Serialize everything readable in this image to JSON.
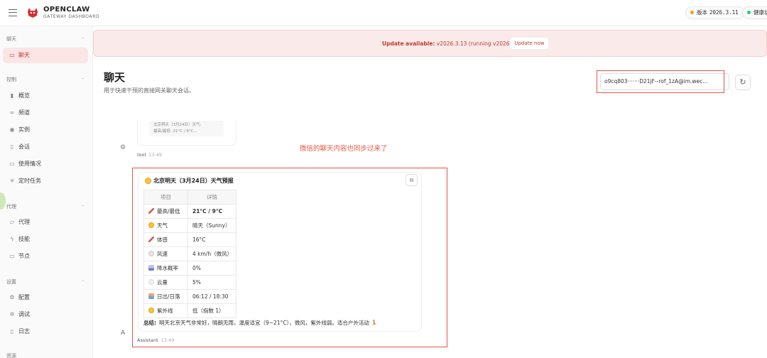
{
  "topbar": {
    "brand_name": "OPENCLAW",
    "brand_subtitle": "GATEWAY DASHBOARD",
    "version_label": "版本",
    "version_value": "2026.3.11",
    "health_label": "健康状"
  },
  "sidebar": {
    "sections": [
      {
        "title": "聊天",
        "chevron": "–"
      },
      {
        "title": "控制",
        "chevron": "–"
      },
      {
        "title": "代理",
        "chevron": "–"
      },
      {
        "title": "设置",
        "chevron": "–"
      },
      {
        "title": "资源",
        "chevron": ""
      }
    ],
    "items": [
      {
        "label": "聊天",
        "icon": "chat-icon",
        "active": true
      },
      {
        "label": "概览",
        "icon": "bar-chart-icon"
      },
      {
        "label": "频道",
        "icon": "link-icon"
      },
      {
        "label": "实例",
        "icon": "radio-icon"
      },
      {
        "label": "会话",
        "icon": "document-icon"
      },
      {
        "label": "使用情况",
        "icon": "stats-icon"
      },
      {
        "label": "定时任务",
        "icon": "loader-icon"
      },
      {
        "label": "代理",
        "icon": "folder-icon"
      },
      {
        "label": "技能",
        "icon": "lightning-icon"
      },
      {
        "label": "节点",
        "icon": "monitor-icon"
      },
      {
        "label": "配置",
        "icon": "gear-icon"
      },
      {
        "label": "调试",
        "icon": "bug-icon"
      },
      {
        "label": "日志",
        "icon": "log-icon"
      }
    ]
  },
  "banner": {
    "prefix": "Update available:",
    "text": " v2026.3.13 (running v2026.3.11).",
    "button": "Update now",
    "color": "#c0392b"
  },
  "header": {
    "title": "聊天",
    "subtitle": "用于快速干预的直接网关聊天会话。",
    "session_value": "o9cq803·······D21jF--rof_1zA@im.wec...",
    "refresh_icon": "refresh-icon"
  },
  "tool_message": {
    "preview_line1": "北京明天（3月24日）天气:",
    "preview_line2": "最高/最低: 21°C / 9°C...",
    "sender": "tool",
    "time": "13:49"
  },
  "annotation": "微信的聊天内容也同步过来了",
  "assistant_message": {
    "title": "北京明天（3月24日）天气预报",
    "table_headers": [
      "项目",
      "详情"
    ],
    "rows": [
      {
        "icon": "therm",
        "item": "最高/最低",
        "detail": "21°C / 9°C",
        "bold": true
      },
      {
        "icon": "sun",
        "item": "天气",
        "detail": "晴天（Sunny）"
      },
      {
        "icon": "therm",
        "item": "体感",
        "detail": "16°C"
      },
      {
        "icon": "wind",
        "item": "风速",
        "detail": "4 km/h（微风）"
      },
      {
        "icon": "rain",
        "item": "降水概率",
        "detail": "0%"
      },
      {
        "icon": "cloud",
        "item": "云量",
        "detail": "5%"
      },
      {
        "icon": "sunrise",
        "item": "日出/日落",
        "detail": "06:12 / 18:30"
      },
      {
        "icon": "sun",
        "item": "紫外线",
        "detail": "低（指数 1）"
      }
    ],
    "summary_label": "总结:",
    "summary_text": "明天北京天气非常好，晴朗无雨，温度适宜（9~21°C），微风，紫外线弱。适合户外活动 🏃",
    "avatar": "A",
    "sender": "Assistant",
    "time": "13:49"
  }
}
